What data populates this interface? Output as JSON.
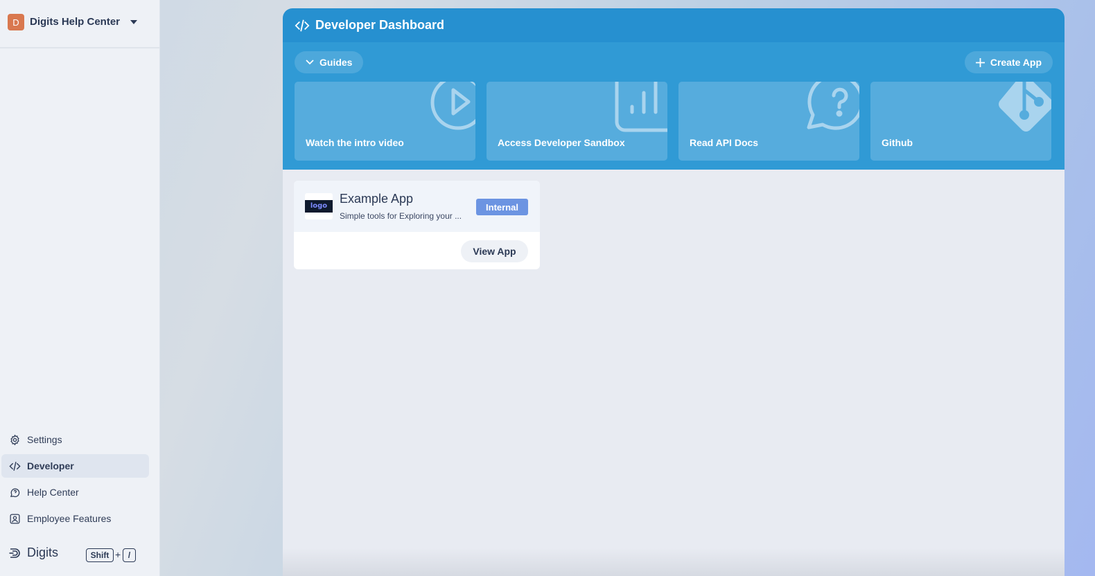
{
  "sidebar": {
    "org": {
      "initial": "D",
      "name": "Digits Help Center"
    },
    "items": [
      {
        "label": "Settings",
        "icon": "gear-icon",
        "active": false
      },
      {
        "label": "Developer",
        "icon": "code-icon",
        "active": true
      },
      {
        "label": "Help Center",
        "icon": "help-bubble-icon",
        "active": false
      },
      {
        "label": "Employee Features",
        "icon": "user-badge-icon",
        "active": false
      }
    ],
    "brand": {
      "name": "Digits",
      "icon": "digits-logo-icon"
    },
    "shortcut": {
      "key1": "Shift",
      "plus": "+",
      "key2": "/"
    }
  },
  "header": {
    "title": "Developer Dashboard",
    "icon": "code-icon"
  },
  "guides": {
    "toggle_label": "Guides",
    "create_label": "Create App",
    "cards": [
      {
        "label": "Watch the intro video",
        "icon": "play-icon"
      },
      {
        "label": "Access Developer Sandbox",
        "icon": "chart-icon"
      },
      {
        "label": "Read API Docs",
        "icon": "question-bubble-icon"
      },
      {
        "label": "Github",
        "icon": "git-icon"
      }
    ]
  },
  "apps": [
    {
      "logo_text": "logo",
      "name": "Example App",
      "description": "Simple tools for Exploring your ...",
      "badge": "Internal",
      "action": "View App"
    }
  ],
  "colors": {
    "header_blue": "#2690d0",
    "guides_blue": "#309ad5",
    "card_blue": "#56acdd",
    "badge_blue": "#6c94e2",
    "org_avatar": "#d9784f"
  }
}
